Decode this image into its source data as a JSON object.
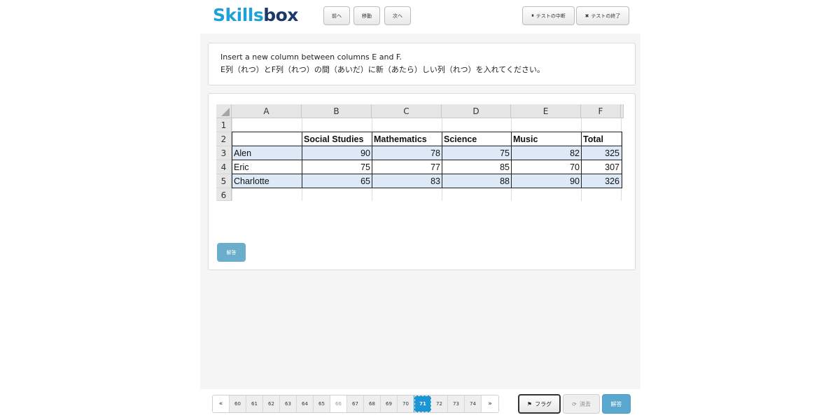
{
  "brand": {
    "logo_part1": "Skills",
    "logo_part2": "box",
    "colors": {
      "skills": "#1ea0d8",
      "box": "#1b3a6b",
      "accent": "#1b95d6"
    }
  },
  "header": {
    "prev_label": "前へ",
    "move_label": "移動",
    "next_label": "次へ",
    "pause_icon": "pause-icon",
    "pause_label": "テストの中断",
    "end_icon": "close-icon",
    "end_label": "テストの終了"
  },
  "question": {
    "line_en": "Insert a new column between columns E and F.",
    "line_ja": "E列（れつ）とF列（れつ）の間（あいだ）に新（あたら）しい列（れつ）を入れてください。"
  },
  "sheet": {
    "columns": [
      "A",
      "B",
      "C",
      "D",
      "E",
      "F"
    ],
    "rows": [
      "1",
      "2",
      "3",
      "4",
      "5",
      "6"
    ],
    "table_header": [
      "",
      "Social Studies",
      "Mathematics",
      "Science",
      "Music",
      "Total"
    ],
    "table_rows": [
      [
        "Alen",
        "90",
        "78",
        "75",
        "82",
        "325"
      ],
      [
        "Eric",
        "75",
        "77",
        "85",
        "70",
        "307"
      ],
      [
        "Charlotte",
        "65",
        "83",
        "88",
        "90",
        "326"
      ]
    ],
    "band_color": "#dde9f6"
  },
  "answer_small_label": "解答",
  "footer": {
    "pager_first": "«",
    "pager_last": "»",
    "pages": [
      "60",
      "61",
      "62",
      "63",
      "64",
      "65",
      "66",
      "67",
      "68",
      "69",
      "70",
      "71",
      "72",
      "73",
      "74"
    ],
    "current_page": "71",
    "visited_page": "66",
    "flag_icon": "flag-icon",
    "flag_label": "フラグ",
    "clear_icon": "refresh-icon",
    "clear_label": "消去",
    "submit_label": "解答"
  }
}
